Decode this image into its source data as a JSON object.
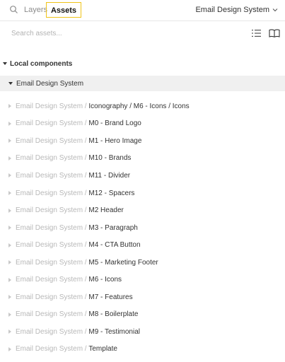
{
  "tabs": {
    "layers_label": "Layers",
    "assets_label": "Assets"
  },
  "library": {
    "selected": "Email Design System"
  },
  "search": {
    "placeholder": "Search assets..."
  },
  "local_components": {
    "section_label": "Local components",
    "group_label": "Email Design System",
    "prefix": "Email Design System / ",
    "items": [
      {
        "name": "Iconography / M6 - Icons / Icons"
      },
      {
        "name": "M0 - Brand Logo"
      },
      {
        "name": "M1 - Hero Image"
      },
      {
        "name": "M10 - Brands"
      },
      {
        "name": "M11 - Divider"
      },
      {
        "name": "M12 - Spacers"
      },
      {
        "name": "M2 Header"
      },
      {
        "name": "M3 - Paragraph"
      },
      {
        "name": "M4 - CTA Button"
      },
      {
        "name": "M5 - Marketing Footer"
      },
      {
        "name": "M6 - Icons"
      },
      {
        "name": "M7 - Features"
      },
      {
        "name": "M8 - Boilerplate"
      },
      {
        "name": "M9 - Testimonial"
      },
      {
        "name": "Template"
      }
    ]
  },
  "icons": {
    "search": "search-icon",
    "dropdown": "chevron-down-icon",
    "list_view": "list-view-icon",
    "library": "book-icon",
    "collapse": "caret-down-icon",
    "expand": "caret-right-icon"
  },
  "colors": {
    "active_tab_border": "#f0c419",
    "muted_text": "#b8b8b8",
    "group_background": "#f0f0f0"
  }
}
